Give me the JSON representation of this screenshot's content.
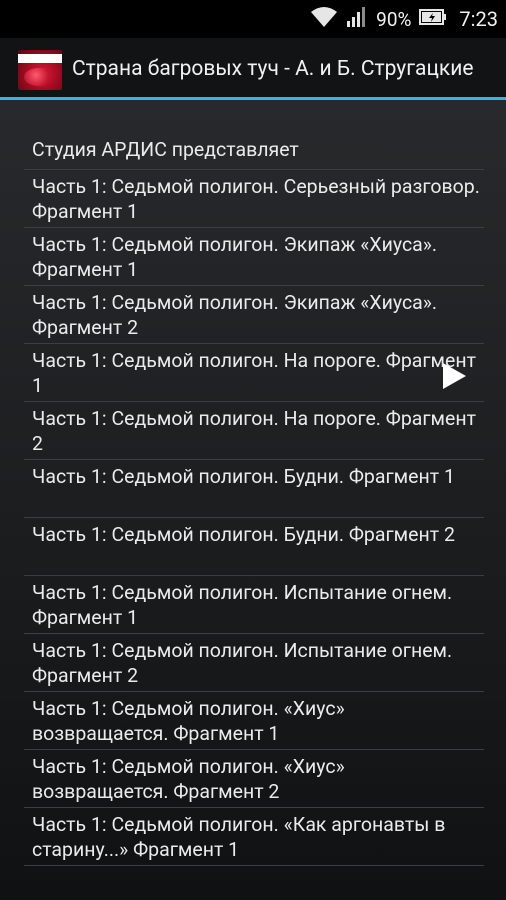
{
  "status_bar": {
    "battery_percent": "90%",
    "time": "7:23",
    "icons": [
      "wifi-icon",
      "signal-icon",
      "battery-icon"
    ]
  },
  "action_bar": {
    "title": "Страна багровых туч  -  А. и Б. Стругацкие",
    "app_icon": "book-cover-icon",
    "accent_color": "#33b5e5"
  },
  "list": {
    "header": "Студия АРДИС представляет",
    "items": [
      {
        "label": "Часть 1: Седьмой полигон. Серьезный разговор. Фрагмент 1"
      },
      {
        "label": "Часть 1: Седьмой полигон. Экипаж «Хиуса». Фрагмент 1"
      },
      {
        "label": "Часть 1: Седьмой полигон. Экипаж «Хиуса». Фрагмент 2"
      },
      {
        "label": "Часть 1: Седьмой полигон. На пороге. Фрагмент 1"
      },
      {
        "label": "Часть 1: Седьмой полигон. На пороге. Фрагмент 2"
      },
      {
        "label": "Часть 1: Седьмой полигон. Будни. Фрагмент 1"
      },
      {
        "label": "Часть 1: Седьмой полигон. Будни. Фрагмент 2"
      },
      {
        "label": "Часть 1: Седьмой полигон. Испытание огнем. Фрагмент 1"
      },
      {
        "label": "Часть 1: Седьмой полигон. Испытание огнем. Фрагмент 2"
      },
      {
        "label": "Часть 1: Седьмой полигон. «Хиус» возвращается. Фрагмент 1"
      },
      {
        "label": "Часть 1: Седьмой полигон. «Хиус» возвращается. Фрагмент 2"
      },
      {
        "label": "Часть 1: Седьмой полигон. «Как аргонавты в старину...» Фрагмент 1"
      }
    ]
  },
  "player": {
    "play_icon": "play-icon"
  }
}
